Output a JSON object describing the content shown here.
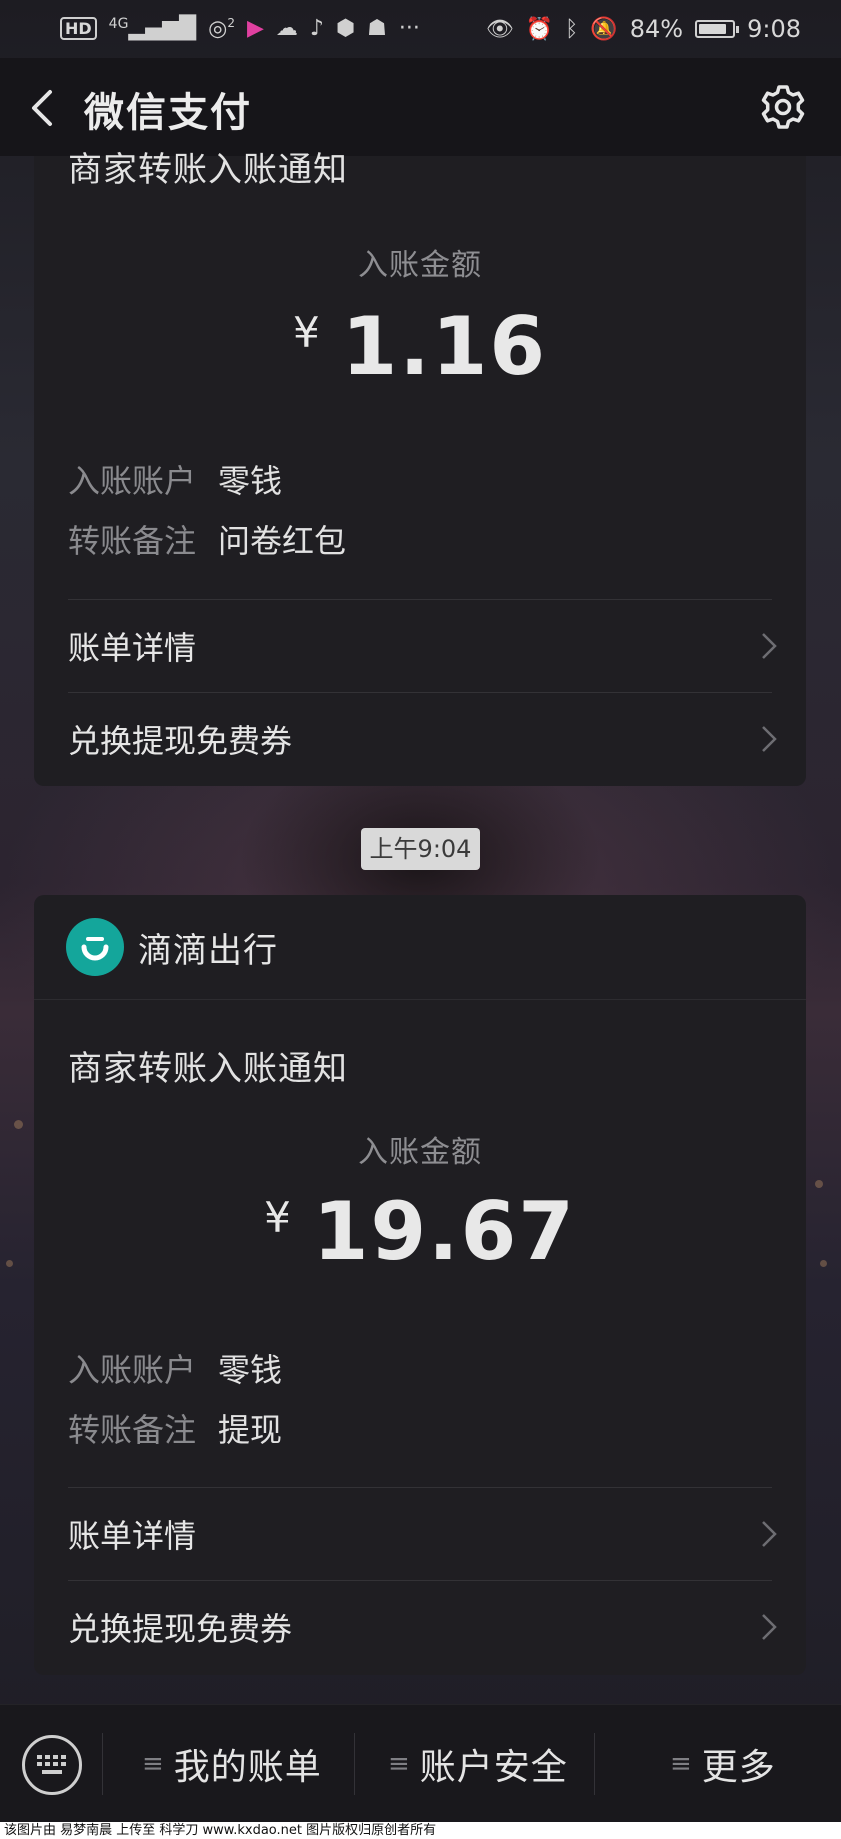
{
  "status_bar": {
    "network": "4G",
    "hotspot_count": "2",
    "more": "···",
    "battery": "84%",
    "battery_level": 0.84,
    "time": "9:08"
  },
  "nav": {
    "title": "微信支付"
  },
  "messages": [
    {
      "title": "商家转账入账通知",
      "amount_label": "入账金额",
      "currency": "¥",
      "amount": "1.16",
      "account_key": "入账账户",
      "account_val": "零钱",
      "remark_key": "转账备注",
      "remark_val": "问卷红包",
      "link1": "账单详情",
      "link2": "兑换提现免费券"
    },
    {
      "merchant": "滴滴出行",
      "title": "商家转账入账通知",
      "amount_label": "入账金额",
      "currency": "¥",
      "amount": "19.67",
      "account_key": "入账账户",
      "account_val": "零钱",
      "remark_key": "转账备注",
      "remark_val": "提现",
      "link1": "账单详情",
      "link2": "兑换提现免费券"
    }
  ],
  "timestamp": "上午9:04",
  "bottom_menu": {
    "item1": "我的账单",
    "item2": "账户安全",
    "item3": "更多"
  },
  "footer": "该图片由 易梦南晨 上传至 科学刀 www.kxdao.net 图片版权归原创者所有",
  "colors": {
    "merchant_logo": "#14a69b",
    "card_bg": "#1f1e22",
    "nav_bg": "#161519"
  }
}
